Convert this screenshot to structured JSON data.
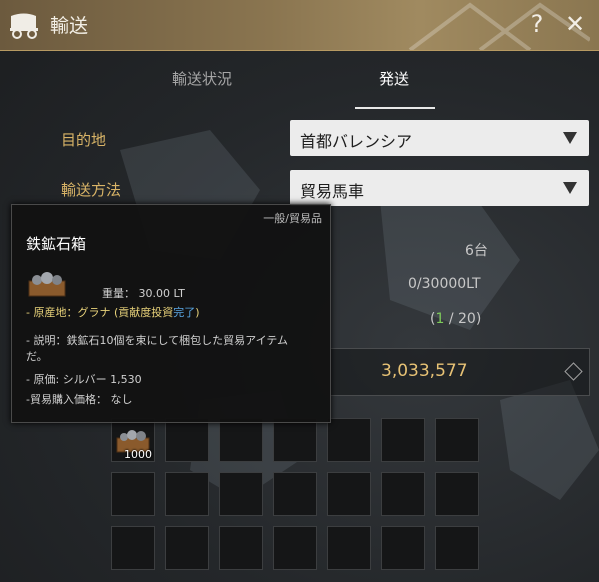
{
  "window": {
    "title": "輸送",
    "help_label": "?",
    "close_label": "✕",
    "icon": "wagon-icon"
  },
  "tabs": [
    {
      "label": "輸送状況",
      "active": false
    },
    {
      "label": "発送",
      "active": true
    }
  ],
  "form": {
    "destination": {
      "label": "目的地",
      "value": "首都バレンシア"
    },
    "method": {
      "label": "輸送方法",
      "value": "貿易馬車"
    }
  },
  "background_info": {
    "available_wagons": "6台",
    "capacity": "0/30000LT",
    "slot_count_open": "(",
    "slot_count_used": "1",
    "slot_count_sep": " / ",
    "slot_count_total": "20",
    "slot_count_close": ")",
    "silver": "3,033,577"
  },
  "inventory": {
    "slots_total": 21,
    "items": [
      {
        "name": "鉄鉱石箱",
        "quantity": "1000",
        "slot": 0
      }
    ]
  },
  "tooltip": {
    "category": "一般/貿易品",
    "name": "鉄鉱石箱",
    "weight": "重量： 30.00 LT",
    "origin_prefix": "- 原産地：グラナ (",
    "origin_mid": "貢献度投資",
    "origin_done": "完了",
    "origin_suffix": ")",
    "description_1": "- 説明：鉄鉱石10個を束にして梱包した貿易アイテム",
    "description_2": "だ。",
    "price": "- 原価: シルバー 1,530",
    "buy_price": "-貿易購入価格： なし"
  },
  "colors": {
    "title_bar": "#8a7550",
    "label_gold": "#d9b467",
    "silver_gold": "#e7c275",
    "green": "#7ecb5b",
    "link_blue": "#5aa8e6"
  }
}
